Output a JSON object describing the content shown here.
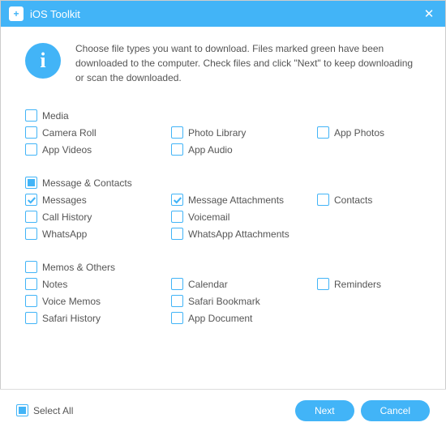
{
  "window": {
    "title": "iOS Toolkit",
    "close_glyph": "✕"
  },
  "info": {
    "glyph": "i",
    "text": "Choose file types you want to download. Files marked green have been downloaded to the computer. Check files and click \"Next\" to keep downloading or scan the downloaded."
  },
  "groups": {
    "g1": {
      "header": "Media",
      "i0": "Camera Roll",
      "i1": "Photo Library",
      "i2": "App Photos",
      "i3": "App Videos",
      "i4": "App Audio"
    },
    "g2": {
      "header": "Message & Contacts",
      "i0": "Messages",
      "i1": "Message Attachments",
      "i2": "Contacts",
      "i3": "Call History",
      "i4": "Voicemail",
      "i5": "WhatsApp",
      "i6": "WhatsApp Attachments"
    },
    "g3": {
      "header": "Memos & Others",
      "i0": "Notes",
      "i1": "Calendar",
      "i2": "Reminders",
      "i3": "Voice Memos",
      "i4": "Safari Bookmark",
      "i5": "Safari History",
      "i6": "App Document"
    }
  },
  "footer": {
    "select_all": "Select All",
    "next": "Next",
    "cancel": "Cancel"
  }
}
